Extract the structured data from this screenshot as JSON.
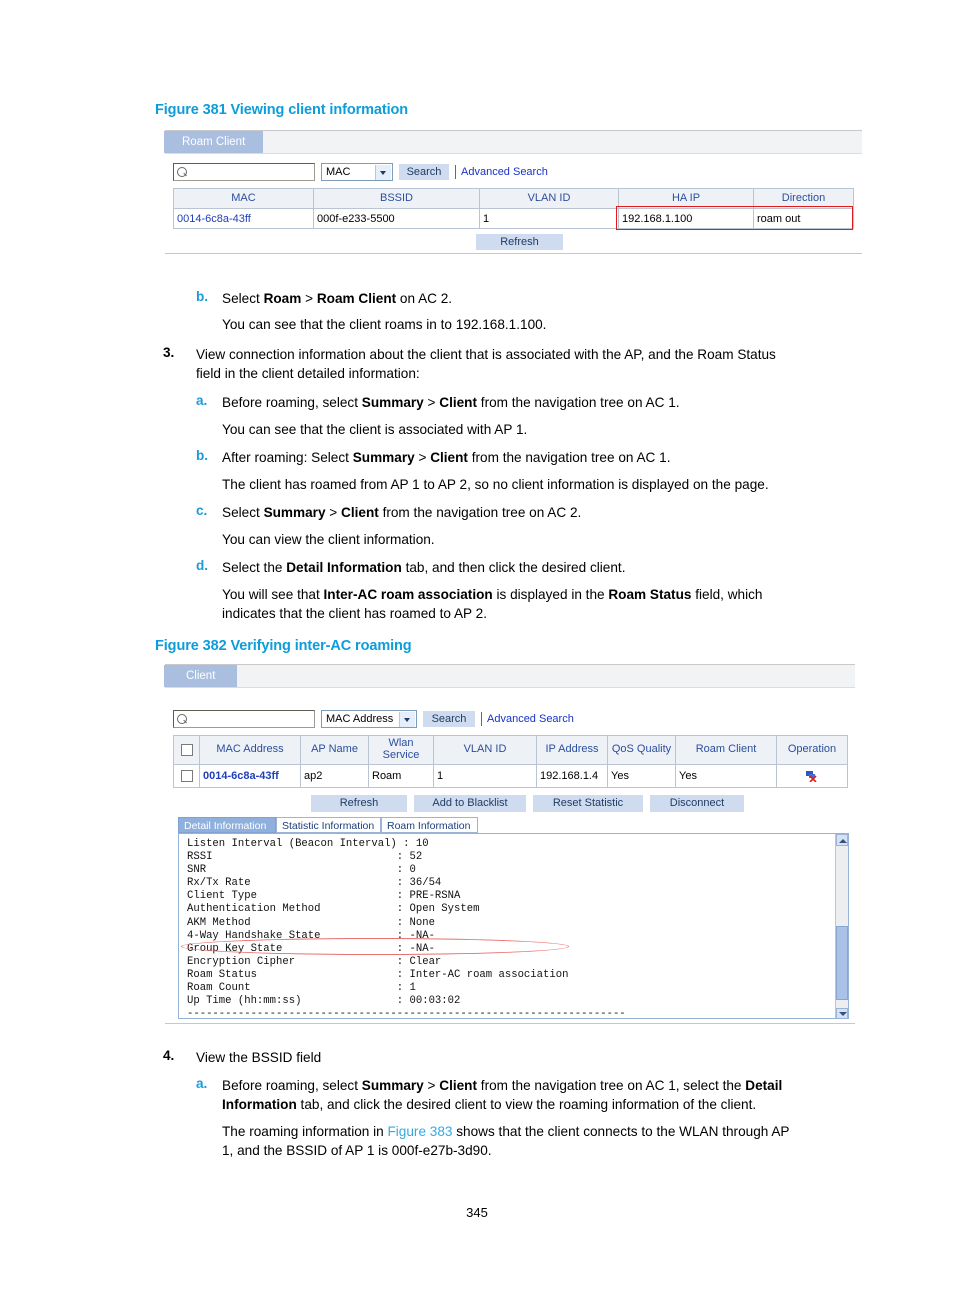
{
  "page": {
    "number": "345"
  },
  "figure381": {
    "caption": "Figure 381 Viewing client information",
    "tab_label": "Roam Client",
    "search": {
      "input_value": "",
      "select_value": "MAC",
      "search_button": "Search",
      "advanced_link": "Advanced Search"
    },
    "table": {
      "headers": [
        "MAC",
        "BSSID",
        "VLAN ID",
        "HA IP",
        "Direction"
      ],
      "rows": [
        [
          "0014-6c8a-43ff",
          "000f-e233-5500",
          "1",
          "192.168.1.100",
          "roam out"
        ]
      ]
    },
    "refresh_button": "Refresh"
  },
  "body1": {
    "item_b_marker": "b.",
    "item_b_pre": "Select ",
    "item_b_bold1": "Roam",
    "item_b_mid": " > ",
    "item_b_bold2": "Roam Client",
    "item_b_post": " on AC 2.",
    "item_b_sub": "You can see that the client roams in to 192.168.1.100.",
    "item_3_marker": "3.",
    "item_3_line1": "View connection information about the client that is associated with the AP, and the Roam Status",
    "item_3_line2": "field in the client detailed information:",
    "item_3a_marker": "a.",
    "item_3a_pre": "Before roaming, select ",
    "item_3a_bold1": "Summary",
    "item_3a_mid": " > ",
    "item_3a_bold2": "Client",
    "item_3a_post": " from the navigation tree on AC 1.",
    "item_3a_sub": "You can see that the client is associated with AP 1.",
    "item_3b_marker": "b.",
    "item_3b_pre": "After roaming: Select ",
    "item_3b_bold1": "Summary",
    "item_3b_mid": " > ",
    "item_3b_bold2": "Client",
    "item_3b_post": " from the navigation tree on AC 1.",
    "item_3b_sub": "The client has roamed from AP 1 to AP 2, so no client information is displayed on the page.",
    "item_3c_marker": "c.",
    "item_3c_pre": "Select ",
    "item_3c_bold1": "Summary",
    "item_3c_mid": " > ",
    "item_3c_bold2": "Client",
    "item_3c_post": " from the navigation tree on AC 2.",
    "item_3c_sub": "You can view the client information.",
    "item_3d_marker": "d.",
    "item_3d_pre": "Select the ",
    "item_3d_bold1": "Detail Information",
    "item_3d_post": " tab, and then click the desired client.",
    "item_3d_sub_pre": "You will see that ",
    "item_3d_sub_bold1": "Inter-AC roam association",
    "item_3d_sub_mid": " is displayed in the ",
    "item_3d_sub_bold2": "Roam Status",
    "item_3d_sub_post": " field, which",
    "item_3d_sub_line2": "indicates that the client has roamed to AP 2."
  },
  "figure382": {
    "caption": "Figure 382 Verifying inter-AC roaming",
    "tab_label": "Client",
    "search": {
      "input_value": "",
      "select_value": "MAC Address",
      "search_button": "Search",
      "advanced_link": "Advanced Search"
    },
    "table": {
      "headers": [
        "",
        "MAC Address",
        "AP Name",
        "Wlan Service",
        "VLAN ID",
        "IP Address",
        "QoS Quality",
        "Roam Client",
        "Operation"
      ],
      "rows": [
        [
          "",
          "0014-6c8a-43ff",
          "ap2",
          "Roam",
          "1",
          "192.168.1.4",
          "Yes",
          "Yes",
          "disconnect-icon"
        ]
      ]
    },
    "buttons": [
      "Refresh",
      "Add to Blacklist",
      "Reset Statistic",
      "Disconnect"
    ],
    "detail_tabs": [
      "Detail Information",
      "Statistic Information",
      "Roam Information"
    ],
    "detail_active_tab": "Detail Information",
    "detail_lines": [
      {
        "label": "Listen Interval (Beacon Interval)",
        "value": "10"
      },
      {
        "label": "RSSI",
        "value": "52"
      },
      {
        "label": "SNR",
        "value": "0"
      },
      {
        "label": "Rx/Tx Rate",
        "value": "36/54"
      },
      {
        "label": "Client Type",
        "value": "PRE-RSNA"
      },
      {
        "label": "Authentication Method",
        "value": "Open System"
      },
      {
        "label": "AKM Method",
        "value": "None"
      },
      {
        "label": "4-Way Handshake State",
        "value": "-NA-"
      },
      {
        "label": "Group Key State",
        "value": "-NA-"
      },
      {
        "label": "Encryption Cipher",
        "value": "Clear"
      },
      {
        "label": "Roam Status",
        "value": "Inter-AC roam association"
      },
      {
        "label": "Roam Count",
        "value": "1"
      },
      {
        "label": "Up Time (hh:mm:ss)",
        "value": "00:03:02"
      }
    ],
    "detail_text": "Listen Interval (Beacon Interval) : 10\nRSSI                             : 52\nSNR                              : 0\nRx/Tx Rate                       : 36/54\nClient Type                      : PRE-RSNA\nAuthentication Method            : Open System\nAKM Method                       : None\n4-Way Handshake State            : -NA-\nGroup Key State                  : -NA-\nEncryption Cipher                : Clear\nRoam Status                      : Inter-AC roam association\nRoam Count                       : 1\nUp Time (hh:mm:ss)               : 00:03:02\n---------------------------------------------------------------------"
  },
  "body2": {
    "item_4_marker": "4.",
    "item_4_text": "View the BSSID field",
    "item_4a_marker": "a.",
    "item_4a_pre": "Before roaming, select ",
    "item_4a_bold1": "Summary",
    "item_4a_mid": " > ",
    "item_4a_bold2": "Client",
    "item_4a_post": " from the navigation tree on AC 1, select the ",
    "item_4a_bold3": "Detail",
    "item_4a_line2_bold": "Information",
    "item_4a_line2_post": " tab, and click the desired client to view the roaming information of the client.",
    "item_4a_sub_pre": "The roaming information in ",
    "item_4a_sub_link": "Figure 383",
    "item_4a_sub_post": " shows that the client connects to the WLAN through AP",
    "item_4a_sub_line2": "1, and the BSSID of AP 1 is 000f-e27b-3d90."
  },
  "colors": {
    "caption": "#0d9ddb",
    "link": "#36a9e1",
    "marker_alpha": "#1b9bd8",
    "highlight": "#e01b1b",
    "tab_active": "#aabee0",
    "button": "#cfdcf0"
  }
}
